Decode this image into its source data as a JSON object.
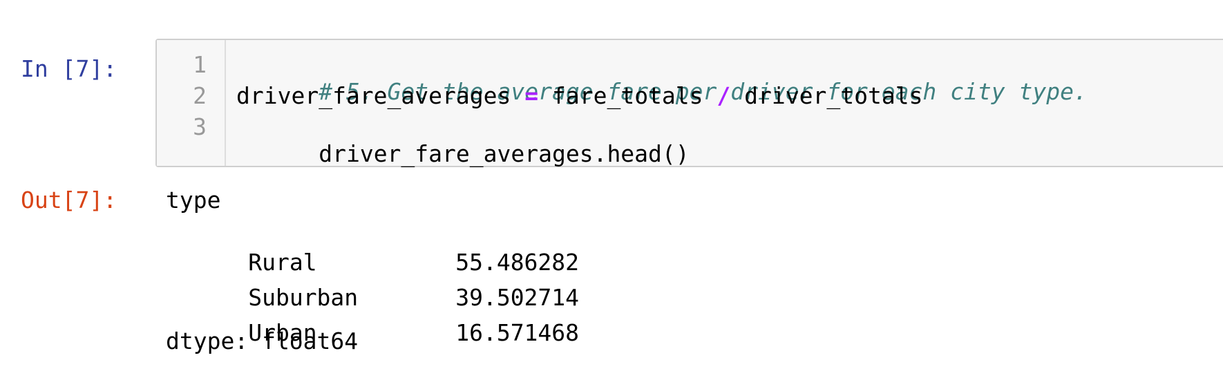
{
  "input_prompt": "In [7]:",
  "output_prompt": "Out[7]:",
  "code": {
    "line_numbers": [
      "1",
      "2",
      "3"
    ],
    "line1_comment": "# 5. Get the average fare per driver for each city type.",
    "line2_lhs": "driver_fare_averages",
    "line2_assign": "=",
    "line2_a": "fare_totals",
    "line2_div": "/",
    "line2_b": "driver_totals",
    "line3": "driver_fare_averages.head()"
  },
  "output": {
    "header": "type",
    "rows": [
      {
        "label": "Rural",
        "value": "55.486282"
      },
      {
        "label": "Suburban",
        "value": "39.502714"
      },
      {
        "label": "Urban",
        "value": "16.571468"
      }
    ],
    "dtype": "dtype: float64"
  },
  "colors": {
    "input_prompt": "#303f9f",
    "output_prompt": "#d84315",
    "comment": "#408080",
    "operator": "#aa22ff",
    "line_number": "#999999",
    "cell_background": "#f7f7f7"
  }
}
